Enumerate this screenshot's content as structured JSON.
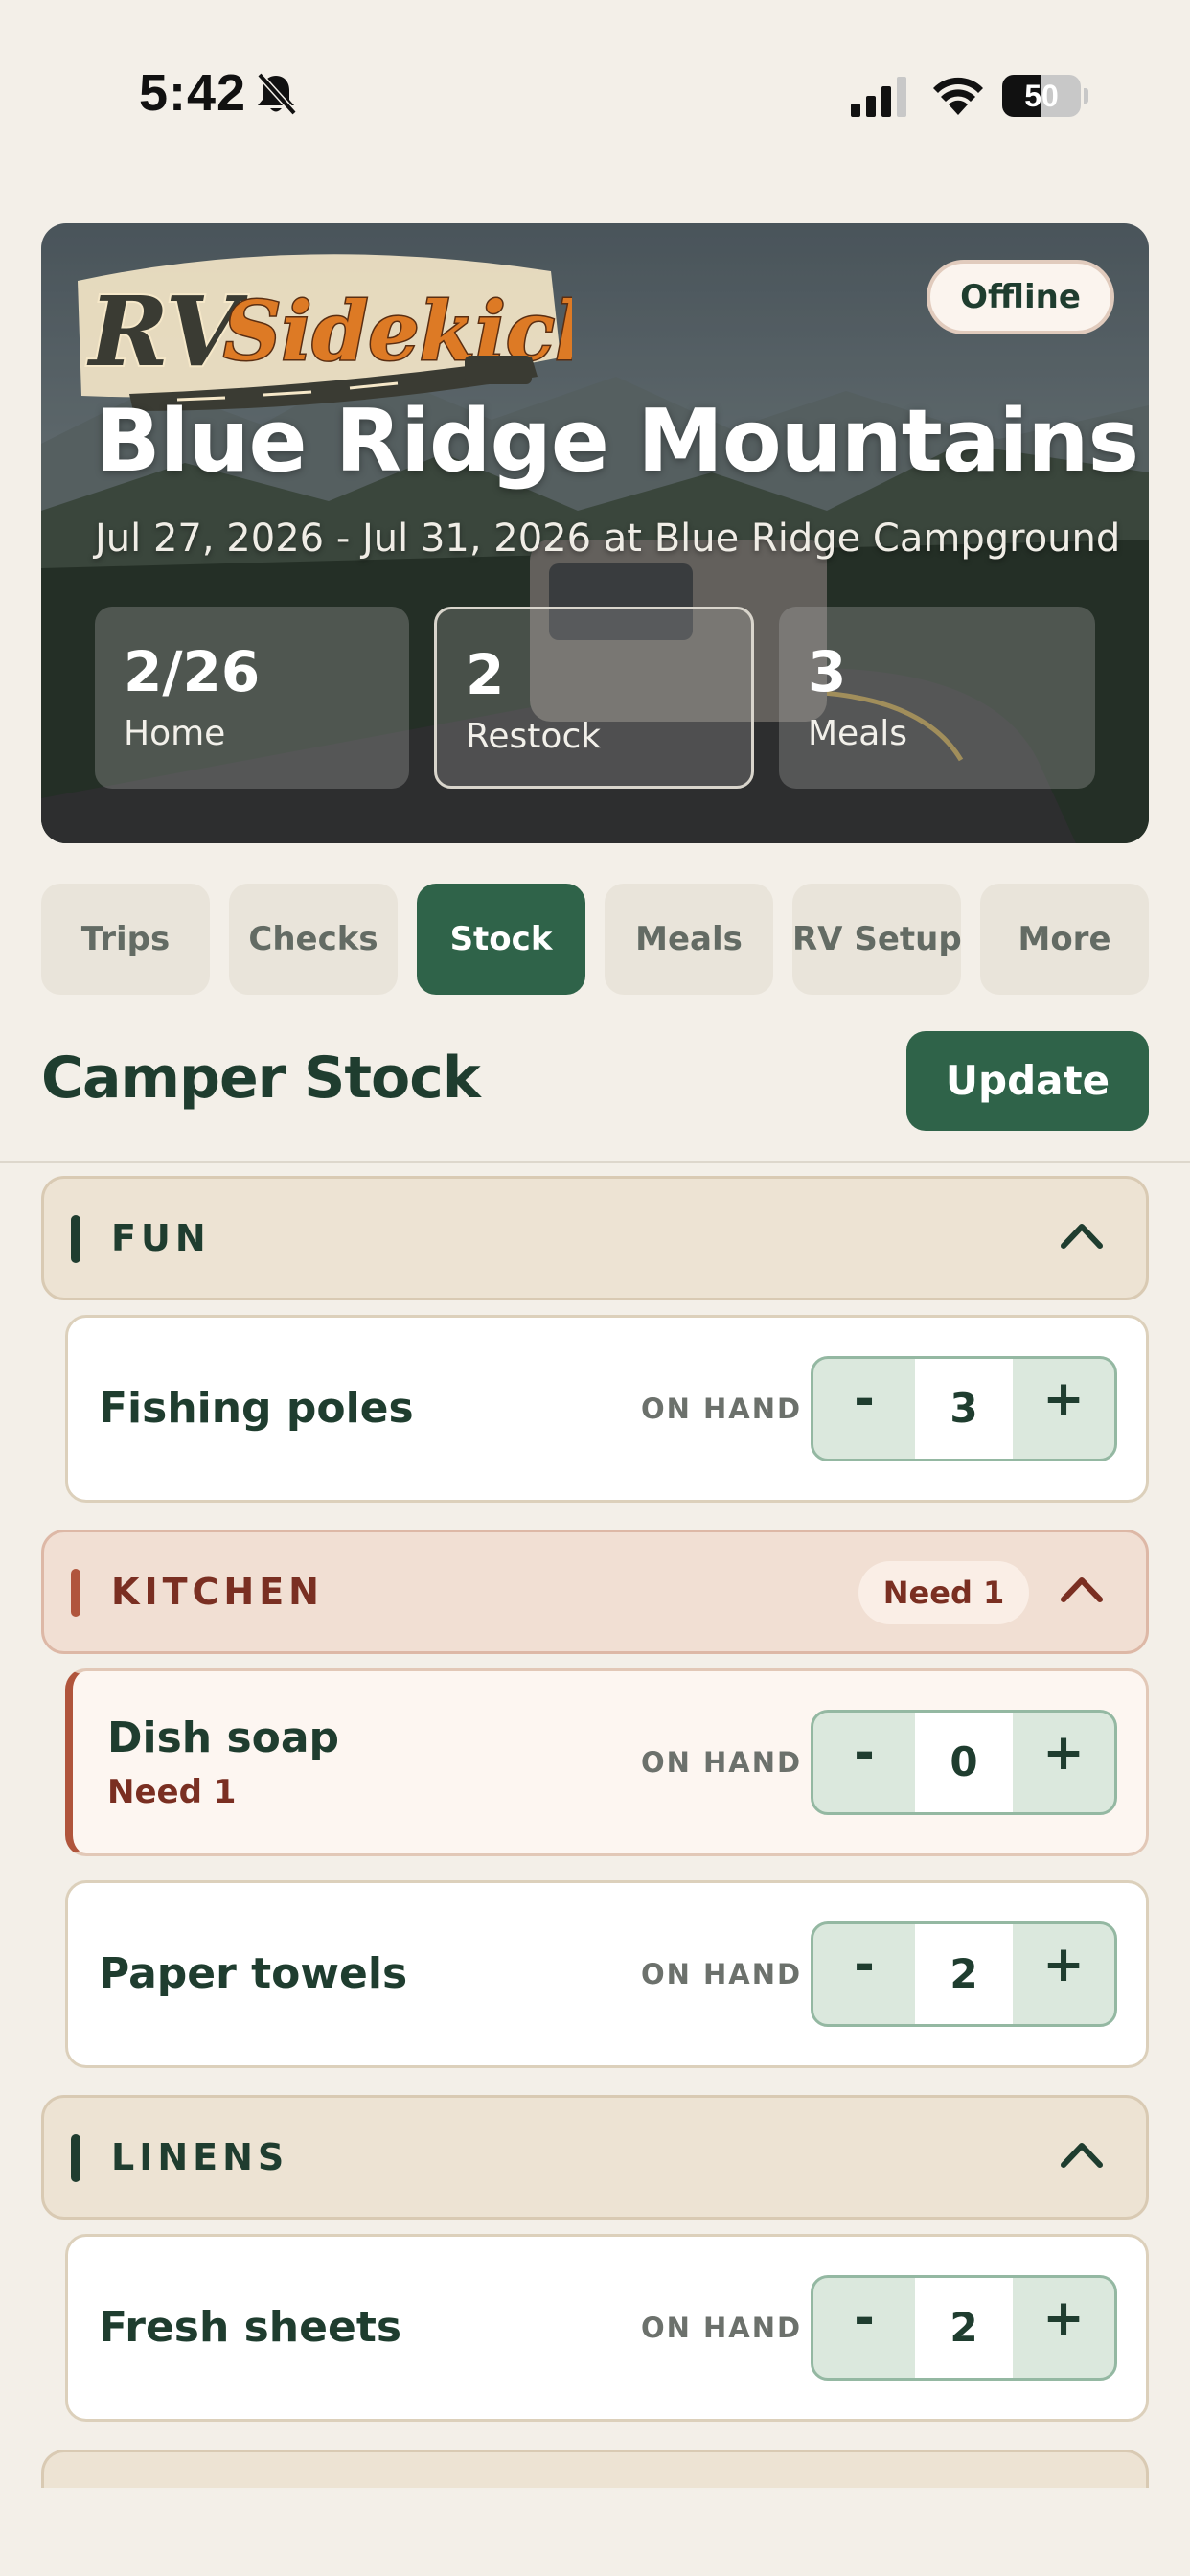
{
  "status_bar": {
    "time": "5:42",
    "battery": "50",
    "battery_level": 0.5
  },
  "hero": {
    "logo_text": "RVSidekick",
    "badge": "Offline",
    "title": "Blue Ridge Mountains",
    "subtitle": "Jul 27, 2026 - Jul 31, 2026 at Blue Ridge Campground",
    "stats": [
      {
        "value": "2/26",
        "label": "Home"
      },
      {
        "value": "2",
        "label": "Restock"
      },
      {
        "value": "3",
        "label": "Meals"
      }
    ]
  },
  "tabs": [
    {
      "label": "Trips"
    },
    {
      "label": "Checks"
    },
    {
      "label": "Stock"
    },
    {
      "label": "Meals"
    },
    {
      "label": "RV Setup"
    },
    {
      "label": "More"
    }
  ],
  "active_tab": "Stock",
  "section": {
    "title": "Camper Stock",
    "update_label": "Update"
  },
  "on_hand_label": "ON HAND",
  "categories": [
    {
      "label": "FUN",
      "items": [
        {
          "name": "Fishing poles",
          "qty": "3"
        }
      ]
    },
    {
      "label": "KITCHEN",
      "need": "Need 1",
      "items": [
        {
          "name": "Dish soap",
          "need": "Need 1",
          "qty": "0"
        },
        {
          "name": "Paper towels",
          "qty": "2"
        }
      ]
    },
    {
      "label": "LINENS",
      "items": [
        {
          "name": "Fresh sheets",
          "qty": "2"
        }
      ]
    }
  ],
  "stepper": {
    "minus": "-",
    "plus": "+"
  },
  "colors": {
    "background": "#f3efe8",
    "primary": "#2f6349",
    "alert": "#b0553c",
    "text": "#1f3d2f"
  }
}
